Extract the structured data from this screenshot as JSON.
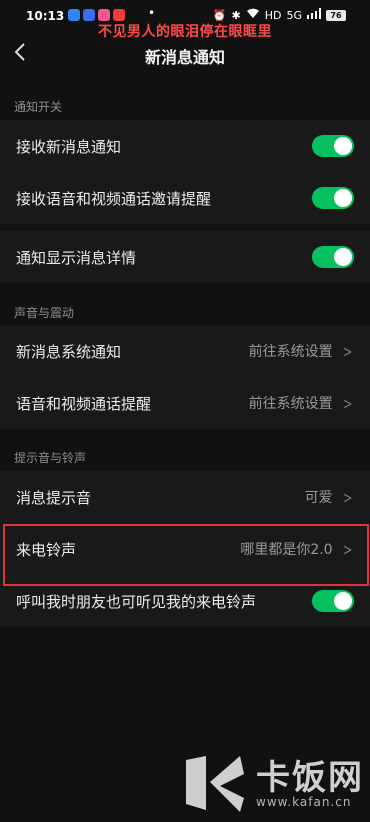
{
  "status_bar": {
    "time": "10:13",
    "dot": "•",
    "battery": "76",
    "net": "HD",
    "signal": "5G"
  },
  "overlay_caption": "不见男人的眼泪停在眼眶里",
  "nav": {
    "title": "新消息通知"
  },
  "sections": {
    "notify": "通知开关",
    "sound": "声音与震动",
    "ringtone": "提示音与铃声"
  },
  "rows": {
    "receive_new": "接收新消息通知",
    "receive_call": "接收语音和视频通话邀请提醒",
    "show_detail": "通知显示消息详情",
    "sys_notify": {
      "label": "新消息系统通知",
      "value": "前往系统设置"
    },
    "call_remind": {
      "label": "语音和视频通话提醒",
      "value": "前往系统设置"
    },
    "msg_tone": {
      "label": "消息提示音",
      "value": "可爱"
    },
    "ringtone": {
      "label": "来电铃声",
      "value": "哪里都是你2.0"
    },
    "friend_hear": "呼叫我时朋友也可听见我的来电铃声"
  },
  "watermark": {
    "brand": "卡饭网",
    "url": "www.kafan.cn"
  },
  "colors": {
    "toggle_on": "#07c160",
    "highlight": "#e03434",
    "caption": "#ff4a4a"
  }
}
